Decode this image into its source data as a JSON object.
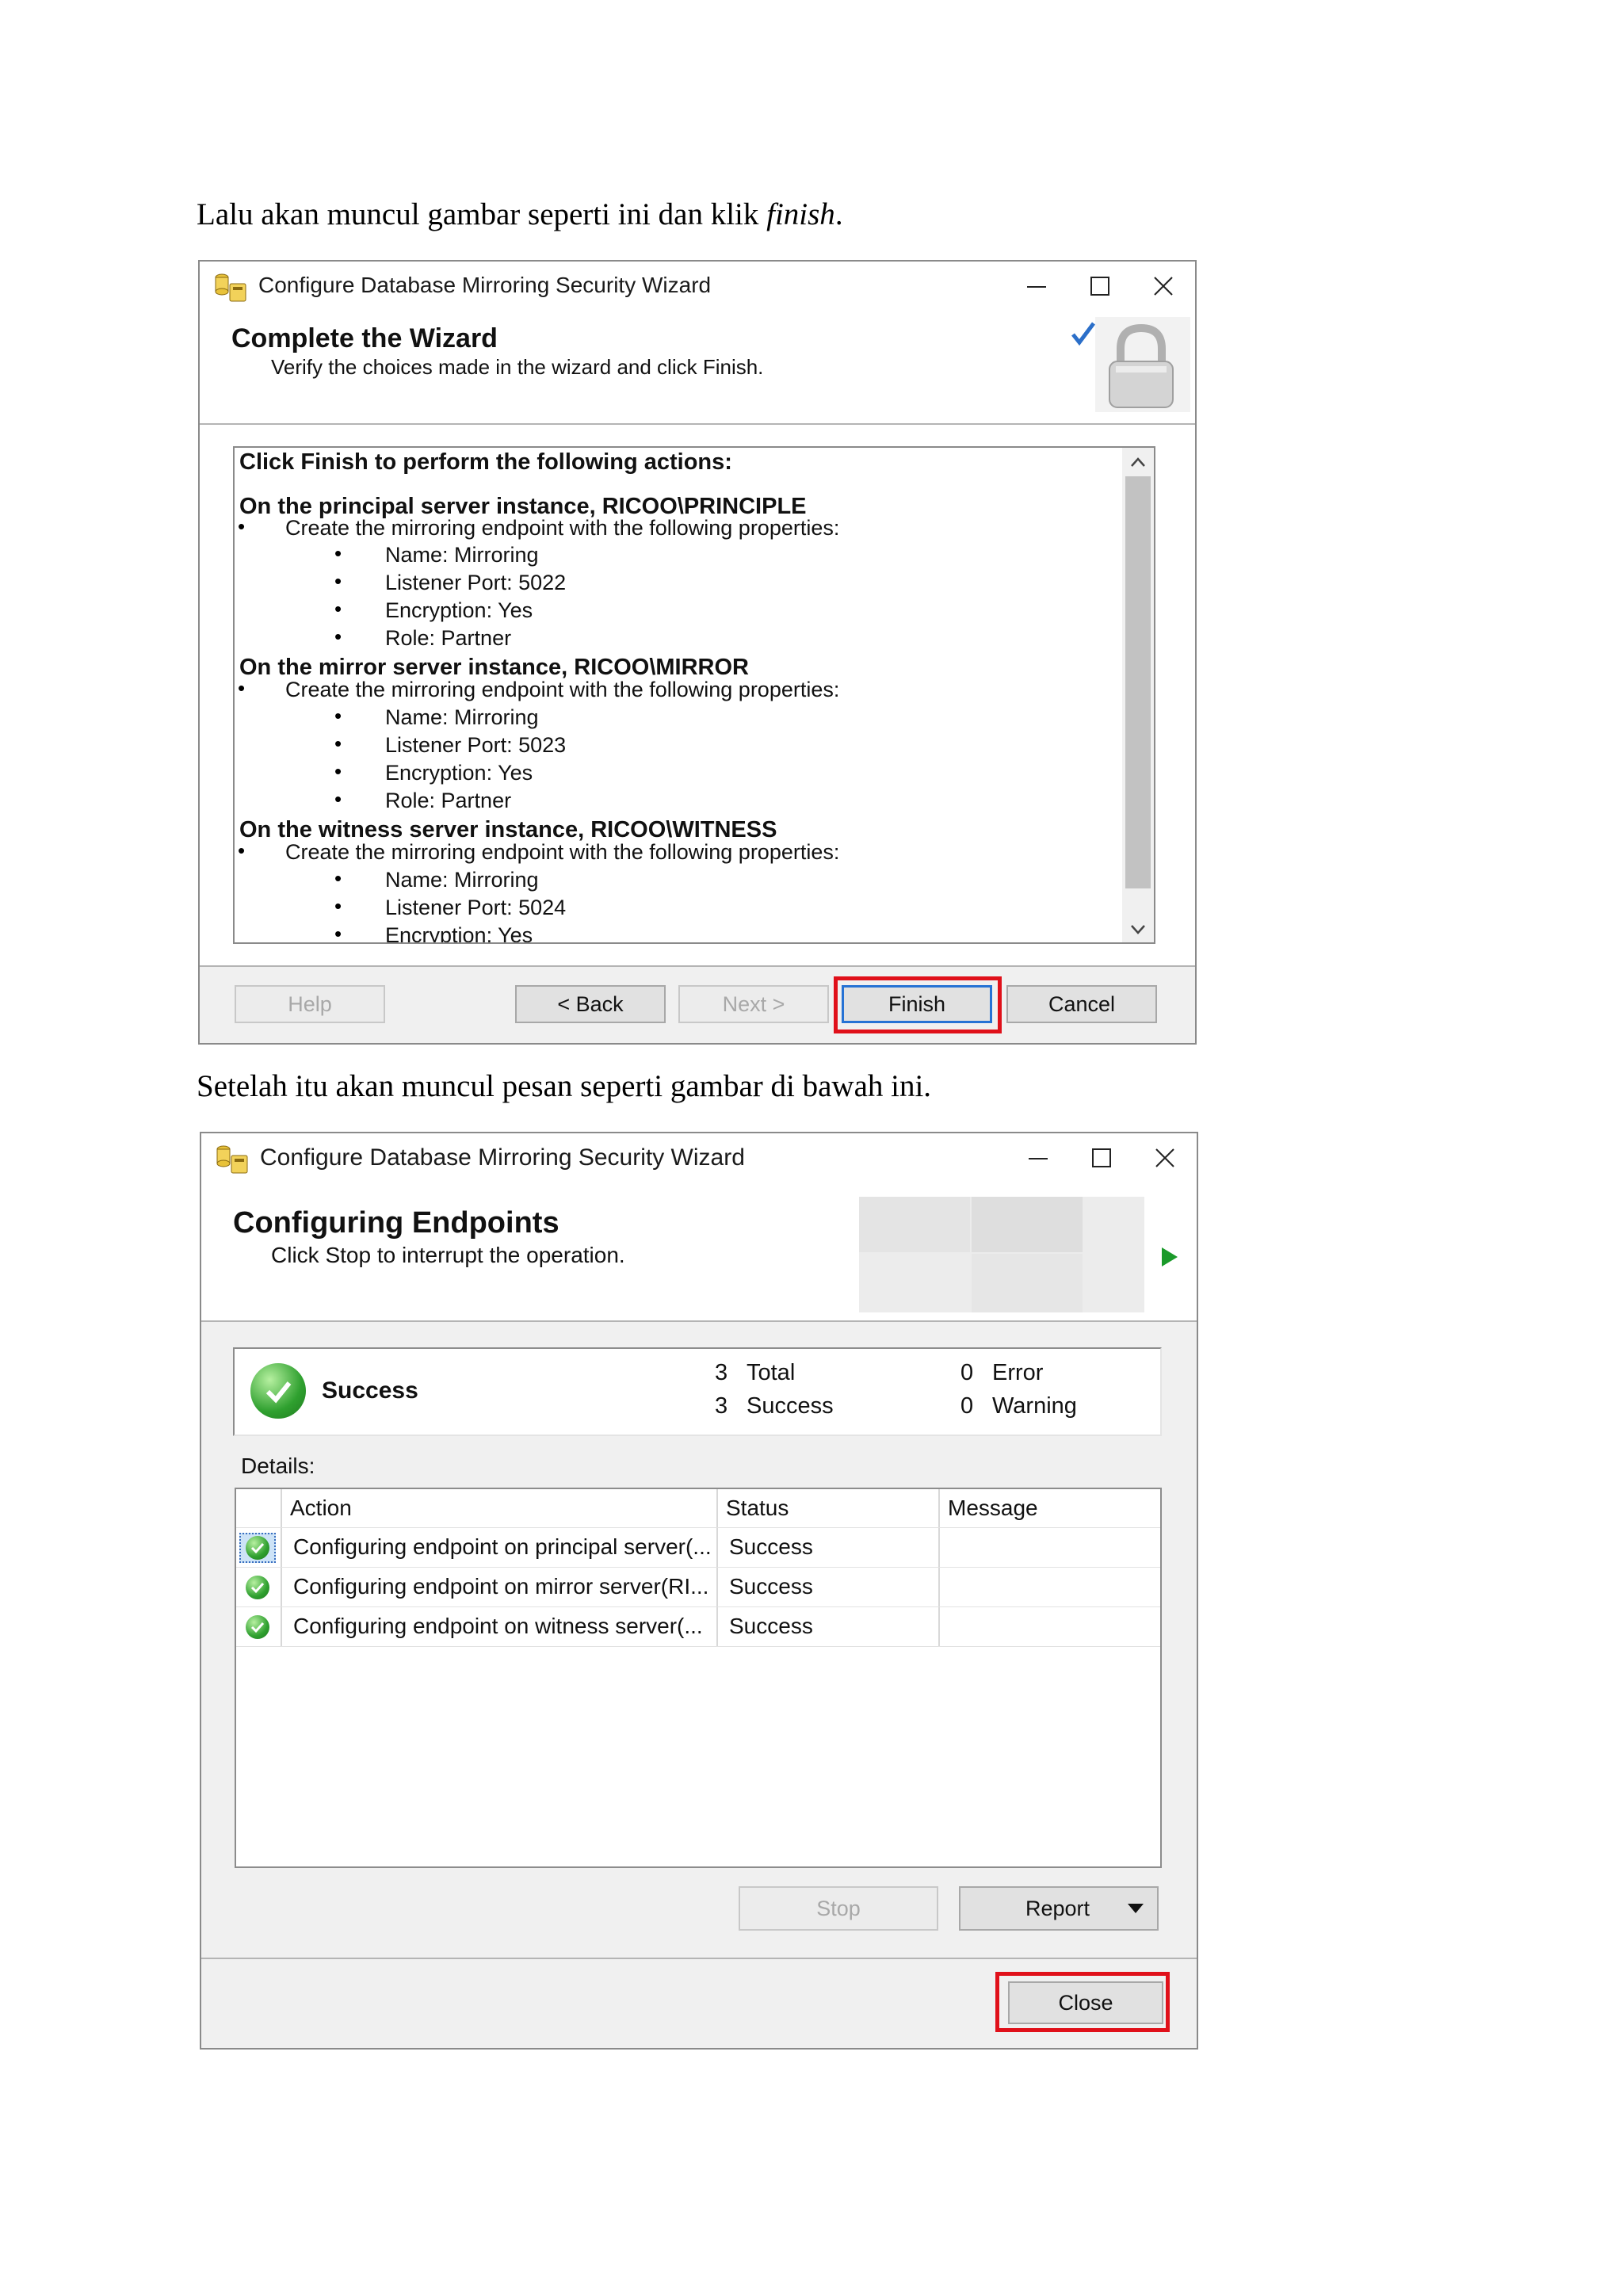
{
  "paragraphs": {
    "p1_text": "Lalu akan muncul gambar seperti ini dan klik ",
    "p1_italic": "finish",
    "p1_end": ".",
    "p2_text": "Setelah itu akan muncul pesan seperti gambar di bawah ini."
  },
  "wizard1": {
    "title": "Configure Database Mirroring Security Wizard",
    "heading": "Complete the Wizard",
    "subheading": "Verify the choices made in the wizard and click Finish.",
    "summary": {
      "intro": "Click Finish to perform the following actions:",
      "principal_header": "On the principal server instance, RICOO\\PRINCIPLE",
      "mirror_header": "On the mirror server instance, RICOO\\MIRROR",
      "witness_header": "On the witness server instance, RICOO\\WITNESS",
      "create_line": "Create the mirroring endpoint with the following properties:",
      "name": "Name: Mirroring",
      "port_principal": "Listener Port: 5022",
      "port_mirror": "Listener Port: 5023",
      "port_witness": "Listener Port: 5024",
      "encryption": "Encryption: Yes",
      "role": "Role: Partner"
    },
    "buttons": {
      "help": "Help",
      "back": "< Back",
      "next": "Next >",
      "finish": "Finish",
      "cancel": "Cancel"
    },
    "highlight_color": "#e0101a"
  },
  "wizard2": {
    "title": "Configure Database Mirroring Security Wizard",
    "heading": "Configuring Endpoints",
    "subheading": "Click Stop to interrupt the operation.",
    "status": {
      "label": "Success",
      "total_count": "3",
      "total_label": "Total",
      "success_count": "3",
      "success_label": "Success",
      "error_count": "0",
      "error_label": "Error",
      "warning_count": "0",
      "warning_label": "Warning"
    },
    "details_label": "Details:",
    "columns": {
      "action": "Action",
      "status": "Status",
      "message": "Message"
    },
    "rows": [
      {
        "action": "Configuring endpoint on principal server(...",
        "status": "Success",
        "message": ""
      },
      {
        "action": "Configuring endpoint on mirror server(RI...",
        "status": "Success",
        "message": ""
      },
      {
        "action": "Configuring endpoint on witness server(...",
        "status": "Success",
        "message": ""
      }
    ],
    "buttons": {
      "stop": "Stop",
      "report": "Report",
      "close": "Close"
    }
  }
}
